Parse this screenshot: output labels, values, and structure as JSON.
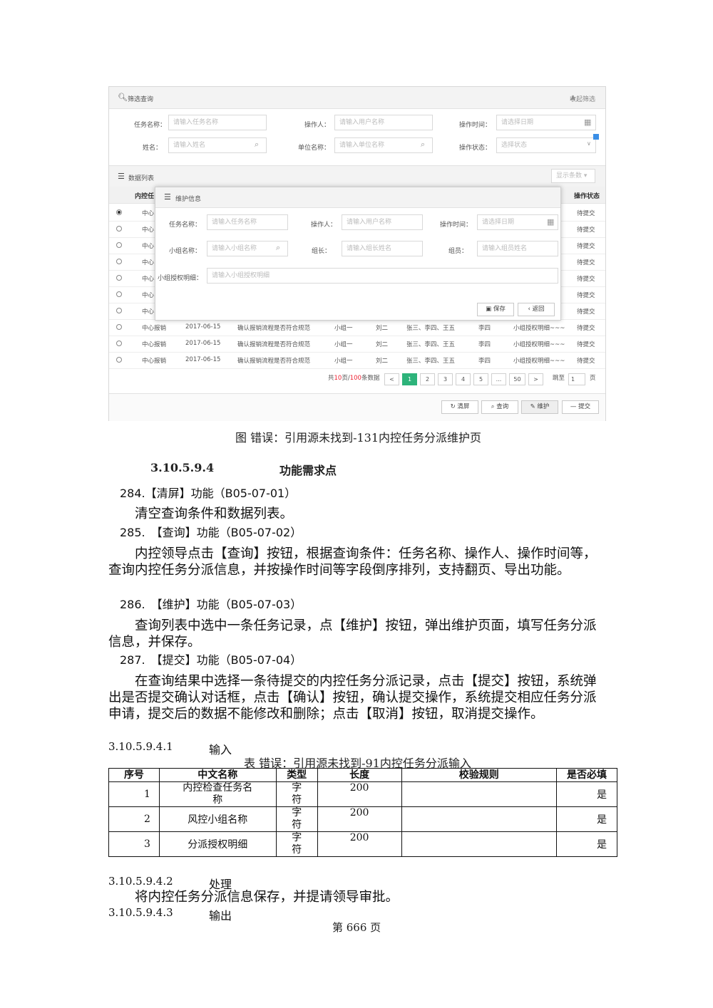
{
  "screenshot": {
    "filter": {
      "title": "筛选查询",
      "collapse": "收起筛选",
      "fields": {
        "task_name": {
          "label": "任务名称：",
          "placeholder": "请输入任务名称"
        },
        "operator": {
          "label": "操作人：",
          "placeholder": "请输入用户名称"
        },
        "op_time": {
          "label": "操作时间：",
          "placeholder": "请选择日期"
        },
        "name": {
          "label": "姓名：",
          "placeholder": "请输入姓名"
        },
        "unit": {
          "label": "单位名称：",
          "placeholder": "请输入单位名称"
        },
        "op_status": {
          "label": "操作状态：",
          "placeholder": "选择状态"
        }
      }
    },
    "list": {
      "title": "数据列表",
      "display_count": "显示条数",
      "col_first": "内控任",
      "col_status": "操作状态",
      "rows_partial": [
        {
          "c1": "中心",
          "status": "待提交",
          "checked": true
        },
        {
          "c1": "中心",
          "status": "待提交",
          "checked": false
        },
        {
          "c1": "中心",
          "status": "待提交",
          "checked": false
        },
        {
          "c1": "中心",
          "status": "待提交",
          "checked": false
        },
        {
          "c1": "中心",
          "status": "待提交",
          "checked": false
        },
        {
          "c1": "中心",
          "status": "待提交",
          "checked": false
        },
        {
          "c1": "中心",
          "status": "待提交",
          "checked": false
        }
      ],
      "rows_full": [
        {
          "c1": "中心报销",
          "date": "2017-06-15",
          "task": "确认报销流程是否符合规范",
          "group": "小组一",
          "leader": "刘二",
          "members": "张三、李四、王五",
          "op": "李四",
          "detail": "小组授权明细~~~",
          "status": "待提交"
        },
        {
          "c1": "中心报销",
          "date": "2017-06-15",
          "task": "确认报销流程是否符合规范",
          "group": "小组一",
          "leader": "刘二",
          "members": "张三、李四、王五",
          "op": "李四",
          "detail": "小组授权明细~~~",
          "status": "待提交"
        },
        {
          "c1": "中心报销",
          "date": "2017-06-15",
          "task": "确认报销流程是否符合规范",
          "group": "小组一",
          "leader": "刘二",
          "members": "张三、李四、王五",
          "op": "李四",
          "detail": "小组授权明细~~~",
          "status": "待提交"
        }
      ]
    },
    "modal": {
      "title": "维护信息",
      "task_name": {
        "label": "任务名称：",
        "placeholder": "请输入任务名称"
      },
      "operator": {
        "label": "操作人：",
        "placeholder": "请输入用户名称"
      },
      "op_time": {
        "label": "操作时间：",
        "placeholder": "请选择日期"
      },
      "group_name": {
        "label": "小组名称：",
        "placeholder": "请输入小组名称"
      },
      "leader": {
        "label": "组长：",
        "placeholder": "请输入组长姓名"
      },
      "member": {
        "label": "组员：",
        "placeholder": "请输入组员姓名"
      },
      "auth": {
        "label": "小组授权明细：",
        "placeholder": "请输入小组授权明细"
      },
      "save": "保存",
      "back": "返回"
    },
    "pager": {
      "summary_pre": "共",
      "pages": "10",
      "summary_mid": "页/",
      "records": "100",
      "summary_post": "条数据",
      "buttons": [
        "<",
        "1",
        "2",
        "3",
        "4",
        "5",
        "...",
        "50",
        ">"
      ],
      "jump_label": "跳至",
      "jump_value": "1",
      "page_suffix": "页"
    },
    "actions": {
      "clear": "清屏",
      "query": "查询",
      "maintain": "维护",
      "submit": "提交"
    }
  },
  "document": {
    "figure_caption": "图 错误：引用源未找到-131内控任务分派维护页",
    "section_num": "3.10.5.9.4",
    "section_title": "功能需求点",
    "items": [
      {
        "head": "284.【清屏】功能（B05-07-01）",
        "body": "清空查询条件和数据列表。"
      },
      {
        "head": "285.　【查询】功能（B05-07-02）",
        "body": "内控领导点击【查询】按钮，根据查询条件：任务名称、操作人、操作时间等，查询内控任务分派信息，并按操作时间等字段倒序排列，支持翻页、导出功能。"
      },
      {
        "head": "286.　【维护】功能（B05-07-03）",
        "body": "查询列表中选中一条任务记录，点【维护】按钮，弹出维护页面，填写任务分派信息，并保存。"
      },
      {
        "head": "287.　【提交】功能（B05-07-04）",
        "body": "在查询结果中选择一条待提交的内控任务分派记录，点击【提交】按钮，系统弹出是否提交确认对话框，点击【确认】按钮，确认提交操作，系统提交相应任务分派申请，提交后的数据不能修改和删除；点击【取消】按钮，取消提交操作。"
      }
    ],
    "input_num": "3.10.5.9.4.1",
    "input_title": "输入",
    "table_caption": "表 错误：引用源未找到-91内控任务分派输入",
    "table": {
      "headers": [
        "序号",
        "中文名称",
        "类型",
        "长度",
        "校验规则",
        "是否必填"
      ],
      "rows": [
        [
          "1",
          "内控检查任务名称",
          "字符",
          "200",
          "",
          "是"
        ],
        [
          "2",
          "风控小组名称",
          "字符",
          "200",
          "",
          "是"
        ],
        [
          "3",
          "分派授权明细",
          "字符",
          "200",
          "",
          "是"
        ]
      ]
    },
    "process_num": "3.10.5.9.4.2",
    "process_title": "处理",
    "process_body": "将内控任务分派信息保存，并提请领导审批。",
    "output_num": "3.10.5.9.4.3",
    "output_title": "输出",
    "page_footer": "第 666 页"
  }
}
